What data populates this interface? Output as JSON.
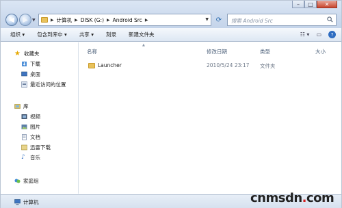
{
  "address_bar": {
    "crumbs": [
      "计算机",
      "DISK (G:)",
      "Android Src"
    ]
  },
  "search": {
    "placeholder": "搜索 Android Src"
  },
  "toolbar": {
    "organize": "组织 ▾",
    "include_in_library": "包含到库中 ▾",
    "share": "共享 ▾",
    "burn": "刻录",
    "new_folder": "新建文件夹"
  },
  "navpane": {
    "favorites": "收藏夹",
    "favorites_items": [
      "下载",
      "桌面",
      "最近访问的位置"
    ],
    "libraries": "库",
    "library_items": [
      "视频",
      "图片",
      "文档",
      "迅雷下载",
      "音乐"
    ],
    "homegroup": "家庭组",
    "computer": "计算机"
  },
  "columns": {
    "name": "名称",
    "date": "修改日期",
    "type": "类型",
    "size": "大小"
  },
  "files": [
    {
      "name": "Launcher",
      "date": "2010/5/24 23:17",
      "type": "文件夹"
    }
  ],
  "watermark": {
    "part1": "cnmsdn",
    "dot": ".",
    "part2": "com"
  },
  "colors": {
    "accent": "#2e6dc1",
    "folder": "#e8c25c",
    "toolbar_bg": "#dde7f3"
  }
}
